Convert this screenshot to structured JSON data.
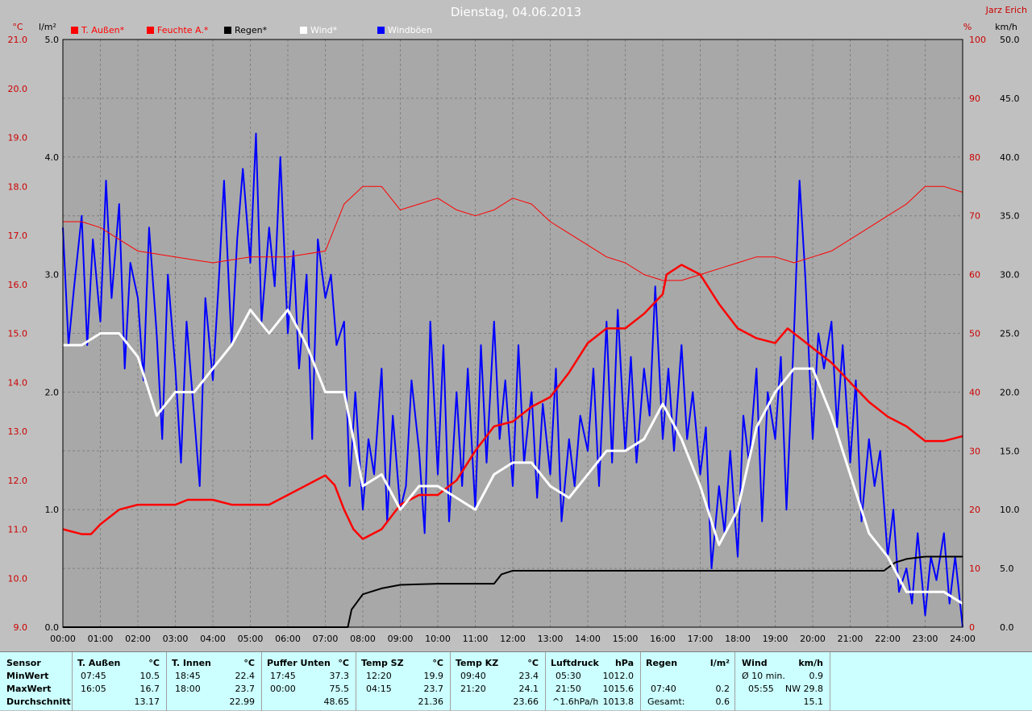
{
  "header": {
    "title": "Dienstag, 04.06.2013",
    "author": "Jarz Erich"
  },
  "colors": {
    "bg": "#c0c0c0",
    "plot_bg": "#a8a8a8",
    "temp": "#ff0000",
    "humidity": "#ff0000",
    "rain": "#000000",
    "wind": "#ffffff",
    "gusts": "#0000ff",
    "axis_temp": "#cc0000",
    "axis_other": "#000000"
  },
  "chart_data": {
    "type": "line",
    "title": "Dienstag, 04.06.2013",
    "x_range": [
      "00:00",
      "24:00"
    ],
    "x_ticks": [
      "00:00",
      "01:00",
      "02:00",
      "03:00",
      "04:00",
      "05:00",
      "06:00",
      "07:00",
      "08:00",
      "09:00",
      "10:00",
      "11:00",
      "12:00",
      "13:00",
      "14:00",
      "15:00",
      "16:00",
      "17:00",
      "18:00",
      "19:00",
      "20:00",
      "21:00",
      "22:00",
      "23:00",
      "24:00"
    ],
    "grid": true,
    "legend_position": "top-left",
    "axes": {
      "temp": {
        "unit": "°C",
        "range": [
          9.0,
          21.0
        ],
        "ticks": [
          "9.0",
          "10.0",
          "11.0",
          "12.0",
          "13.0",
          "14.0",
          "15.0",
          "16.0",
          "17.0",
          "18.0",
          "19.0",
          "20.0",
          "21.0"
        ]
      },
      "rain": {
        "unit": "l/m²",
        "range": [
          0.0,
          5.0
        ],
        "ticks": [
          "0.0",
          "1.0",
          "2.0",
          "3.0",
          "4.0",
          "5.0"
        ]
      },
      "humidity": {
        "unit": "%",
        "range": [
          0,
          100
        ],
        "ticks": [
          "0",
          "10",
          "20",
          "30",
          "40",
          "50",
          "60",
          "70",
          "80",
          "90",
          "100"
        ]
      },
      "wind": {
        "unit": "km/h",
        "range": [
          0.0,
          50.0
        ],
        "ticks": [
          "0.0",
          "5.0",
          "10.0",
          "15.0",
          "20.0",
          "25.0",
          "30.0",
          "35.0",
          "40.0",
          "45.0",
          "50.0"
        ]
      }
    },
    "series": [
      {
        "name": "T. Außen*",
        "axis": "temp",
        "color": "#ff0000",
        "x": [
          0,
          0.5,
          0.75,
          1,
          1.5,
          2,
          3,
          3.33,
          4,
          4.5,
          5,
          5.5,
          6,
          6.5,
          7,
          7.25,
          7.5,
          7.75,
          8,
          8.5,
          9,
          9.5,
          10,
          10.5,
          11,
          11.5,
          12,
          12.5,
          13,
          13.5,
          14,
          14.5,
          15,
          15.5,
          16,
          16.1,
          16.5,
          17,
          17.5,
          18,
          18.5,
          19,
          19.33,
          19.67,
          20,
          20.5,
          21,
          21.5,
          22,
          22.5,
          23,
          23.5,
          24
        ],
        "y": [
          11.0,
          10.9,
          10.9,
          11.1,
          11.4,
          11.5,
          11.5,
          11.6,
          11.6,
          11.5,
          11.5,
          11.5,
          11.7,
          11.9,
          12.1,
          11.9,
          11.4,
          11.0,
          10.8,
          11.0,
          11.5,
          11.7,
          11.7,
          12.0,
          12.6,
          13.1,
          13.2,
          13.5,
          13.7,
          14.2,
          14.8,
          15.1,
          15.1,
          15.4,
          15.8,
          16.2,
          16.4,
          16.2,
          15.6,
          15.1,
          14.9,
          14.8,
          15.1,
          14.9,
          14.7,
          14.4,
          14.0,
          13.6,
          13.3,
          13.1,
          12.8,
          12.8,
          12.9
        ]
      },
      {
        "name": "Feuchte A.*",
        "axis": "humidity",
        "color": "#ff0000",
        "x": [
          0,
          0.5,
          1,
          1.5,
          2,
          3,
          4,
          5,
          6,
          7,
          7.5,
          8,
          8.5,
          9,
          9.5,
          10,
          10.5,
          11,
          11.5,
          12,
          12.5,
          13,
          13.5,
          14,
          14.5,
          15,
          15.5,
          16,
          16.5,
          17,
          17.5,
          18,
          18.5,
          19,
          19.5,
          20,
          20.5,
          21,
          21.5,
          22,
          22.5,
          23,
          23.5,
          24
        ],
        "y": [
          69,
          69,
          68,
          66,
          64,
          63,
          62,
          63,
          63,
          64,
          72,
          75,
          75,
          71,
          72,
          73,
          71,
          70,
          71,
          73,
          72,
          69,
          67,
          65,
          63,
          62,
          60,
          59,
          59,
          60,
          61,
          62,
          63,
          63,
          62,
          63,
          64,
          66,
          68,
          70,
          72,
          75,
          75,
          74
        ]
      },
      {
        "name": "Regen*",
        "axis": "rain",
        "color": "#000000",
        "x": [
          0,
          7.6,
          7.7,
          8,
          8.5,
          9,
          10,
          11,
          11.5,
          11.7,
          12,
          13,
          14,
          15,
          16,
          17,
          18,
          19,
          20,
          21,
          21.9,
          22.2,
          22.5,
          23,
          23.5,
          24
        ],
        "y": [
          0,
          0,
          0.15,
          0.28,
          0.33,
          0.36,
          0.37,
          0.37,
          0.37,
          0.45,
          0.48,
          0.48,
          0.48,
          0.48,
          0.48,
          0.48,
          0.48,
          0.48,
          0.48,
          0.48,
          0.48,
          0.55,
          0.58,
          0.6,
          0.6,
          0.6
        ]
      },
      {
        "name": "Wind*",
        "axis": "wind",
        "color": "#ffffff",
        "x": [
          0,
          0.5,
          1,
          1.5,
          2,
          2.5,
          3,
          3.5,
          4,
          4.5,
          5,
          5.5,
          6,
          6.5,
          7,
          7.5,
          8,
          8.5,
          9,
          9.5,
          10,
          10.5,
          11,
          11.5,
          12,
          12.5,
          13,
          13.5,
          14,
          14.5,
          15,
          15.5,
          16,
          16.5,
          17,
          17.5,
          18,
          18.5,
          19,
          19.5,
          20,
          20.5,
          21,
          21.5,
          22,
          22.5,
          23,
          23.5,
          24
        ],
        "y": [
          24,
          24,
          25,
          25,
          23,
          18,
          20,
          20,
          22,
          24,
          27,
          25,
          27,
          24,
          20,
          20,
          12,
          13,
          10,
          12,
          12,
          11,
          10,
          13,
          14,
          14,
          12,
          11,
          13,
          15,
          15,
          16,
          19,
          16,
          12,
          7,
          10,
          17,
          20,
          22,
          22,
          18,
          13,
          8,
          6,
          3,
          3,
          3,
          2
        ]
      },
      {
        "name": "Windböen",
        "axis": "wind",
        "color": "#0000ff",
        "x": [
          0,
          0.15,
          0.3,
          0.5,
          0.65,
          0.8,
          1,
          1.15,
          1.3,
          1.5,
          1.65,
          1.8,
          2,
          2.15,
          2.3,
          2.5,
          2.65,
          2.8,
          3,
          3.15,
          3.3,
          3.5,
          3.65,
          3.8,
          4,
          4.15,
          4.3,
          4.5,
          4.65,
          4.8,
          5,
          5.15,
          5.3,
          5.5,
          5.65,
          5.8,
          6,
          6.15,
          6.3,
          6.5,
          6.65,
          6.8,
          7,
          7.15,
          7.3,
          7.5,
          7.65,
          7.8,
          8,
          8.15,
          8.3,
          8.5,
          8.65,
          8.8,
          9,
          9.15,
          9.3,
          9.5,
          9.65,
          9.8,
          10,
          10.15,
          10.3,
          10.5,
          10.65,
          10.8,
          11,
          11.15,
          11.3,
          11.5,
          11.65,
          11.8,
          12,
          12.15,
          12.3,
          12.5,
          12.65,
          12.8,
          13,
          13.15,
          13.3,
          13.5,
          13.65,
          13.8,
          14,
          14.15,
          14.3,
          14.5,
          14.65,
          14.8,
          15,
          15.15,
          15.3,
          15.5,
          15.65,
          15.8,
          16,
          16.15,
          16.3,
          16.5,
          16.65,
          16.8,
          17,
          17.15,
          17.3,
          17.5,
          17.65,
          17.8,
          18,
          18.15,
          18.3,
          18.5,
          18.65,
          18.8,
          19,
          19.15,
          19.3,
          19.5,
          19.65,
          19.8,
          20,
          20.15,
          20.3,
          20.5,
          20.65,
          20.8,
          21,
          21.15,
          21.3,
          21.5,
          21.65,
          21.8,
          22,
          22.15,
          22.3,
          22.5,
          22.65,
          22.8,
          23,
          23.15,
          23.3,
          23.5,
          23.65,
          23.8,
          24
        ],
        "y": [
          34,
          24,
          29,
          35,
          24,
          33,
          26,
          38,
          28,
          36,
          22,
          31,
          28,
          21,
          34,
          25,
          16,
          30,
          22,
          14,
          26,
          18,
          12,
          28,
          21,
          29,
          38,
          24,
          33,
          39,
          31,
          42,
          26,
          34,
          29,
          40,
          25,
          32,
          22,
          30,
          16,
          33,
          28,
          30,
          24,
          26,
          12,
          20,
          10,
          16,
          13,
          22,
          9,
          18,
          10,
          12,
          21,
          15,
          8,
          26,
          13,
          24,
          9,
          20,
          12,
          22,
          10,
          24,
          14,
          26,
          16,
          21,
          12,
          24,
          14,
          20,
          11,
          19,
          13,
          22,
          9,
          16,
          12,
          18,
          15,
          22,
          12,
          26,
          14,
          27,
          15,
          23,
          14,
          22,
          18,
          29,
          16,
          22,
          15,
          24,
          16,
          20,
          13,
          17,
          5,
          12,
          8,
          15,
          6,
          18,
          14,
          22,
          9,
          20,
          16,
          23,
          10,
          25,
          38,
          30,
          16,
          25,
          22,
          26,
          17,
          24,
          14,
          21,
          9,
          16,
          12,
          15,
          6,
          10,
          3,
          5,
          2,
          8,
          1,
          6,
          4,
          8,
          2,
          6,
          0
        ]
      }
    ]
  },
  "stats": {
    "sensor": {
      "header": "Sensor",
      "min": "MinWert",
      "max": "MaxWert",
      "avg": "Durchschnitt"
    },
    "t_aussen": {
      "header": "T. Außen",
      "unit": "°C",
      "min_time": "07:45",
      "min": "10.5",
      "max_time": "16:05",
      "max": "16.7",
      "avg": "13.17"
    },
    "t_innen": {
      "header": "T. Innen",
      "unit": "°C",
      "min_time": "18:45",
      "min": "22.4",
      "max_time": "18:00",
      "max": "23.7",
      "avg": "22.99"
    },
    "puffer": {
      "header": "Puffer Unten",
      "unit": "°C",
      "min_time": "17:45",
      "min": "37.3",
      "max_time": "00:00",
      "max": "75.5",
      "avg": "48.65"
    },
    "temp_sz": {
      "header": "Temp SZ",
      "unit": "°C",
      "min_time": "12:20",
      "min": "19.9",
      "max_time": "04:15",
      "max": "23.7",
      "avg": "21.36"
    },
    "temp_kz": {
      "header": "Temp KZ",
      "unit": "°C",
      "min_time": "09:40",
      "min": "23.4",
      "max_time": "21:20",
      "max": "24.1",
      "avg": "23.66"
    },
    "luftdruck": {
      "header": "Luftdruck",
      "unit": "hPa",
      "min_time": "05:30",
      "min": "1012.0",
      "max_time": "21:50",
      "max": "1015.6",
      "avg_label": "^1.6hPa/h",
      "avg": "1013.8"
    },
    "regen": {
      "header": "Regen",
      "unit": "l/m²",
      "max_time": "07:40",
      "max": "0.2",
      "total_label": "Gesamt:",
      "total": "0.6"
    },
    "wind": {
      "header": "Wind",
      "unit": "km/h",
      "min_label": "Ø 10 min.",
      "min": "0.9",
      "max_time": "05:55",
      "max": "NW 29.8",
      "avg": "15.1"
    }
  }
}
